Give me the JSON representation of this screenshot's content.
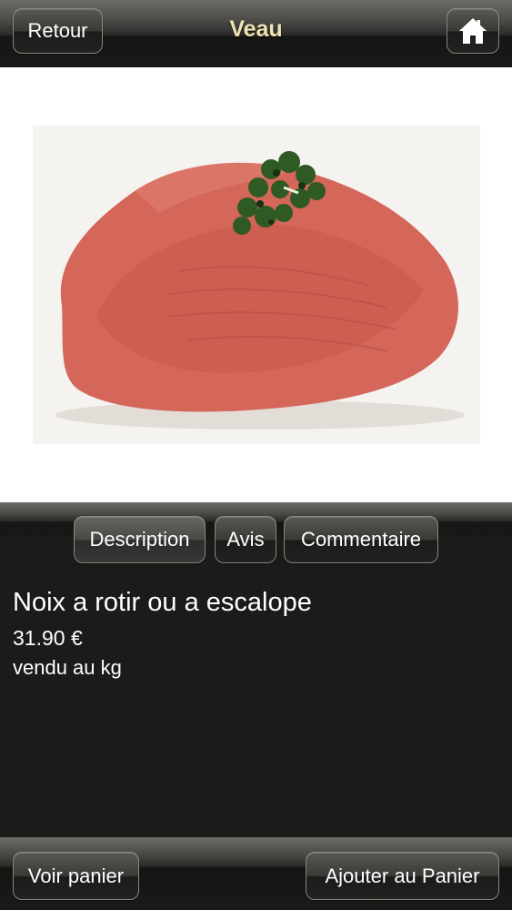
{
  "header": {
    "title": "Veau",
    "back_label": "Retour",
    "home_icon": "home-icon"
  },
  "product": {
    "image": "meat-cut-with-parsley",
    "name": "Noix a rotir ou a escalope",
    "price": "31.90 €",
    "unit": "vendu au kg"
  },
  "tabs": [
    {
      "label": "Description",
      "active": true
    },
    {
      "label": "Avis",
      "active": false
    },
    {
      "label": "Commentaire",
      "active": false
    }
  ],
  "footer": {
    "cart_label": "Voir panier",
    "add_label": "Ajouter au Panier"
  },
  "colors": {
    "background": "#1c1b1a",
    "title": "#efe3b4",
    "text": "#ffffff"
  }
}
